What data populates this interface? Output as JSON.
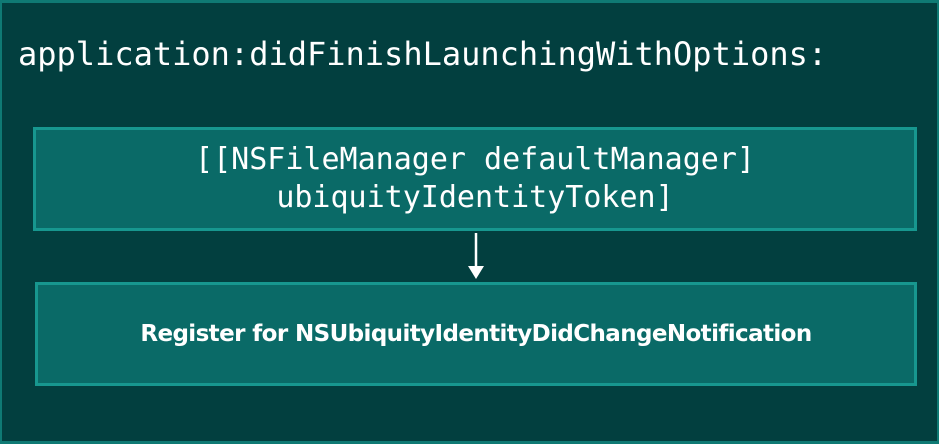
{
  "container": {
    "title": "application:didFinishLaunchingWithOptions:"
  },
  "steps": [
    {
      "line1": "[[NSFileManager defaultManager]",
      "line2": "ubiquityIdentityToken]"
    },
    {
      "label": "Register for NSUbiquityIdentityDidChangeNotification"
    }
  ],
  "colors": {
    "container_fill": "#023f3f",
    "container_border": "#0f7a74",
    "box_fill": "#0a6a67",
    "box_border": "#17978f",
    "arrow": "#ffffff",
    "text": "#ffffff"
  }
}
